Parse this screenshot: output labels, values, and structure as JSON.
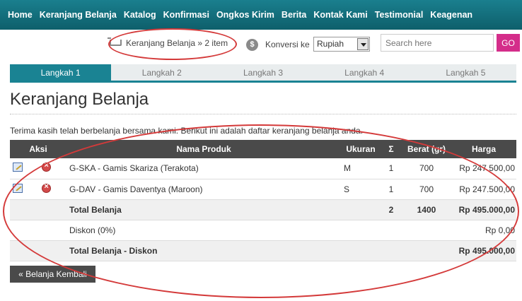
{
  "nav": [
    "Home",
    "Keranjang Belanja",
    "Katalog",
    "Konfirmasi",
    "Ongkos Kirim",
    "Berita",
    "Kontak Kami",
    "Testimonial",
    "Keagenan"
  ],
  "cart_text": "Keranjang Belanja » 2 item",
  "currency_label": "Konversi ke",
  "currency_value": "Rupiah",
  "search_placeholder": "Search here",
  "go_label": "GO",
  "steps": [
    "Langkah 1",
    "Langkah 2",
    "Langkah 3",
    "Langkah 4",
    "Langkah 5"
  ],
  "active_step": 0,
  "page_title": "Keranjang Belanja",
  "intro": "Terima kasih telah berbelanja bersama kami. Berikut ini adalah daftar keranjang belanja anda.",
  "columns": [
    "Aksi",
    "Nama Produk",
    "Ukuran",
    "Σ",
    "Berat (gr)",
    "Harga"
  ],
  "items": [
    {
      "name": "G-SKA - Gamis Skariza (Terakota)",
      "size": "M",
      "qty": "1",
      "weight": "700",
      "price": "Rp 247.500,00"
    },
    {
      "name": "G-DAV - Gamis Daventya (Maroon)",
      "size": "S",
      "qty": "1",
      "weight": "700",
      "price": "Rp 247.500,00"
    }
  ],
  "total": {
    "label": "Total Belanja",
    "qty": "2",
    "weight": "1400",
    "price": "Rp 495.000,00"
  },
  "discount": {
    "label": "Diskon (0%)",
    "price": "Rp 0,00"
  },
  "total_after": {
    "label": "Total Belanja - Diskon",
    "price": "Rp 495.000,00"
  },
  "back_label": "« Belanja Kembali",
  "colors": {
    "teal": "#1a8393",
    "header": "#4a4a4a",
    "go": "#d42d8a",
    "annotation": "#d43a3a"
  }
}
